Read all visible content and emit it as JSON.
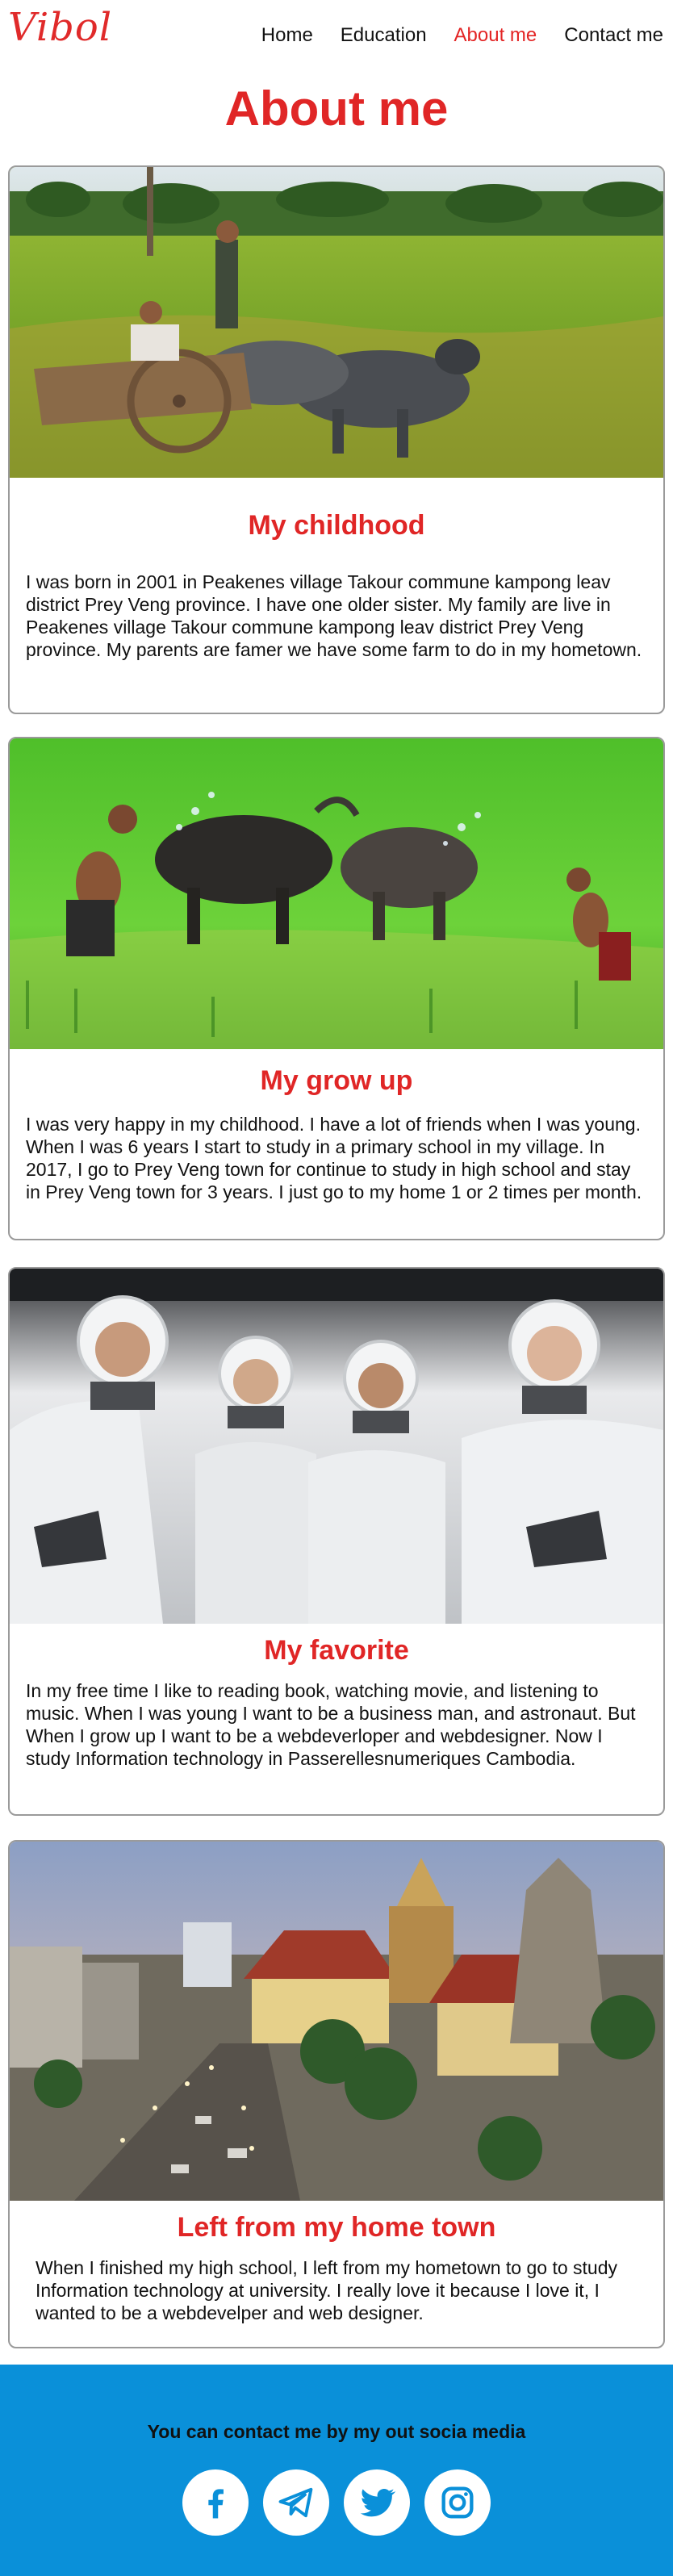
{
  "brand": {
    "logo": "Vibol",
    "accent": "#e02626",
    "footer_bg": "#0a90d9"
  },
  "nav": {
    "items": [
      {
        "label": "Home",
        "active": false
      },
      {
        "label": "Education",
        "active": false
      },
      {
        "label": "About me",
        "active": true
      },
      {
        "label": "Contact me",
        "active": false
      }
    ]
  },
  "page": {
    "title": "About me"
  },
  "cards": [
    {
      "title": "My childhood",
      "text": "I was born in 2001 in Peakenes village Takour commune kampong leav district Prey Veng province. I have one older sister. My family are live in Peakenes village Takour commune kampong leav district Prey Veng province. My parents are famer we have some farm to do in my hometown."
    },
    {
      "title": "My grow up",
      "text": "I was very happy in my childhood. I have a lot of friends when I was young. When I was 6 years I start to study in a primary school in my village. In 2017, I go to Prey Veng town for continue to study in high school and stay in Prey Veng town for 3 years. I just go to my home 1 or 2 times per month."
    },
    {
      "title": "My favorite",
      "text": "In my free time I like to reading book, watching movie, and listening to music. When I was young I want to be a business man, and astronaut. But When I grow up I want to be a webdeverloper and webdesigner. Now I study Information technology in Passerellesnumeriques Cambodia."
    },
    {
      "title": "Left from my home town",
      "text": "When I finished my high school, I left from my hometown to go to study Information technology at university. I really love it because I love it, I wanted to be a webdevelper and web designer."
    }
  ],
  "footer": {
    "text": "You can contact me by my out socia media",
    "social": [
      "facebook-icon",
      "telegram-icon",
      "twitter-icon",
      "instagram-icon"
    ]
  }
}
